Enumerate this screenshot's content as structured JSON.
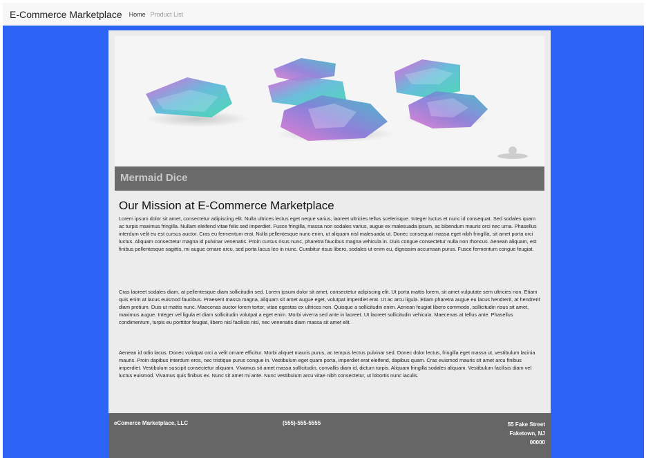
{
  "nav": {
    "brand": "E-Commerce Marketplace",
    "links": [
      "Home",
      "Product List"
    ]
  },
  "featured": {
    "image_alt": "Iridescent teal and pink polyhedral dice set",
    "caption": "Mermaid Dice"
  },
  "mission": {
    "title": "Our Mission at E-Commerce Marketplace",
    "paragraphs": [
      "Lorem ipsum dolor sit amet, consectetur adipiscing elit. Nulla ultrices lectus eget neque varius, laoreet ultricies tellus scelerisque. Integer luctus et nunc id consequat. Sed sodales quam ac turpis maximus fringilla. Nullam eleifend vitae felis sed imperdiet. Fusce fringilla, massa non sodales varius, augue ex malesuada ipsum, ac bibendum mauris orci nec urna. Phasellus interdum velit eu est cursus auctor. Cras eu fermentum erat. Nulla pellentesque nunc enim, ut aliquam nisl malesuada ut. Donec consequat massa eget nibh fringilla, sit amet porta orci luctus. Aliquam consectetur magna id pulvinar venenatis. Proin cursus risus nunc, pharetra faucibus magna vehicula in. Duis congue consectetur nulla non rhoncus. Aenean aliquam, est finibus pellentesque sagittis, mi augue ornare arcu, sed porta lacus leo in nunc. Curabitur risus libero, sodales ut enim eu, dignissim accumsan purus. Fusce fermentum congue feugiat.",
      "Cras laoreet sodales diam, at pellentesque diam sollicitudin sed. Lorem ipsum dolor sit amet, consectetur adipiscing elit. Ut porta mattis lorem, sit amet vulputate sem ultricies non. Etiam quis enim at lacus euismod faucibus. Praesent massa magna, aliquam sit amet augue eget, volutpat imperdiet erat. Ut ac arcu ligula. Etiam pharetra augue eu lacus hendrerit, at hendrerit diam pretium. Duis ut mattis nunc. Maecenas auctor lorem tortor, vitae egestas ex ultrices non. Quisque a sollicitudin enim. Aenean feugiat libero commodo, sollicitudin risus sit amet, maximus augue. Integer vel ligula et diam sollicitudin volutpat a eget enim. Morbi viverra sed ante in laoreet. Ut laoreet sollicitudin vehicula. Maecenas at tellus ante. Phasellus condimentum, turpis eu porttitor feugiat, libero nisl facilisis nisl, nec venenatis diam massa sit amet elit.",
      "Aenean id odio lacus. Donec volutpat orci a velit ornare efficitur. Morbi aliquet mauris purus, ac tempus lectus pulvinar sed. Donec dolor lectus, fringilla eget massa ut, vestibulum lacinia mauris. Proin dapibus interdum eros, nec tristique purus congue in. Vestibulum eget quam porta, imperdiet erat eleifend, dapibus quam. Cras euismod mauris sit amet arcu finibus imperdiet. Vestibulum suscipit consectetur aliquam. Vivamus sit amet massa sollicitudin, convallis diam id, dictum turpis. Aliquam fringilla sodales aliquam. Vestibulum facilisis diam vel luctus euismod. Vivamus quis finibus ex. Nunc sit amet mi ante. Nunc vestibulum arcu vitae nibh consectetur, ut lobortis nunc iaculis."
    ]
  },
  "footer": {
    "company": "eComerce Marketplace, LLC",
    "phone": "(555)-555-5555",
    "address_line1": "55 Fake Street",
    "address_line2": "Faketown, NJ",
    "address_line3": "00000"
  },
  "colors": {
    "page_bg": "#2d63f5",
    "navbar_bg": "#f7f7f7",
    "panel_bg": "#ececec",
    "caption_bg": "#6b6b6b",
    "footer_bg": "#666666"
  }
}
